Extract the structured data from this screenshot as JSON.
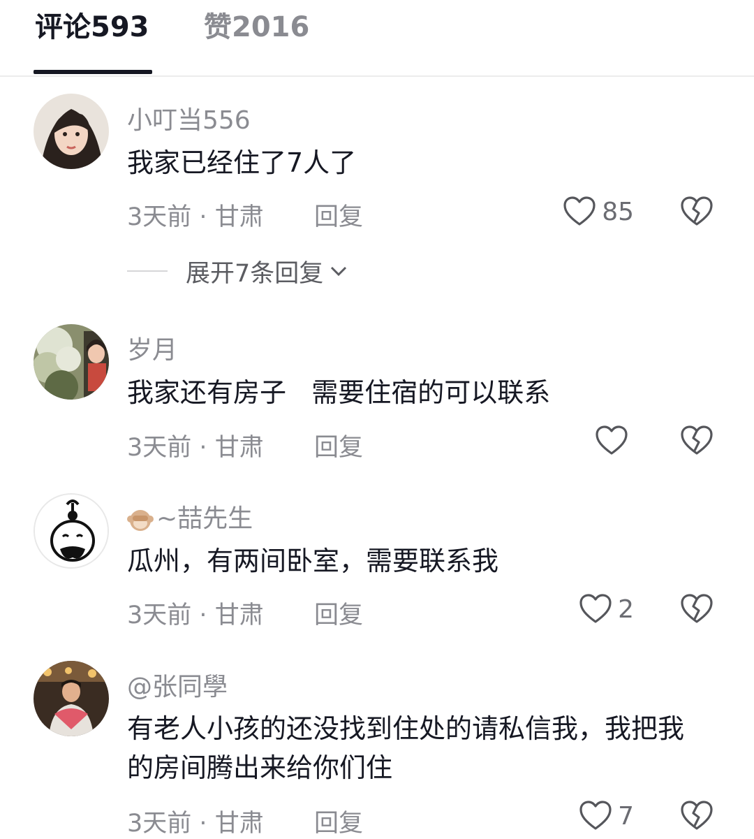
{
  "tabs": {
    "comments_label": "评论",
    "comments_count": "593",
    "likes_label": "赞",
    "likes_count": "2016"
  },
  "comments": [
    {
      "username": "小叮当556",
      "content": "我家已经住了7人了",
      "time": "3天前",
      "location": "甘肃",
      "reply_label": "回复",
      "likes": "85",
      "expand_label": "展开7条回复"
    },
    {
      "username": "岁月",
      "content": "我家还有房子   需要住宿的可以联系",
      "time": "3天前",
      "location": "甘肃",
      "reply_label": "回复",
      "likes": ""
    },
    {
      "username": "~喆先生",
      "username_emoji": "monkey-emoji",
      "content": "瓜州，有两间卧室，需要联系我",
      "time": "3天前",
      "location": "甘肃",
      "reply_label": "回复",
      "likes": "2"
    },
    {
      "username": "@张同學",
      "content": "有老人小孩的还没找到住处的请私信我，我把我的房间腾出来给你们住",
      "time": "3天前",
      "location": "甘肃",
      "reply_label": "回复",
      "likes": "7"
    }
  ],
  "meta_separator": "·",
  "icons": {
    "like": "heart-outline-icon",
    "dislike": "broken-heart-icon",
    "expand": "chevron-down-icon"
  },
  "colors": {
    "primary_text": "#161823",
    "secondary_text": "#8a8b91"
  }
}
